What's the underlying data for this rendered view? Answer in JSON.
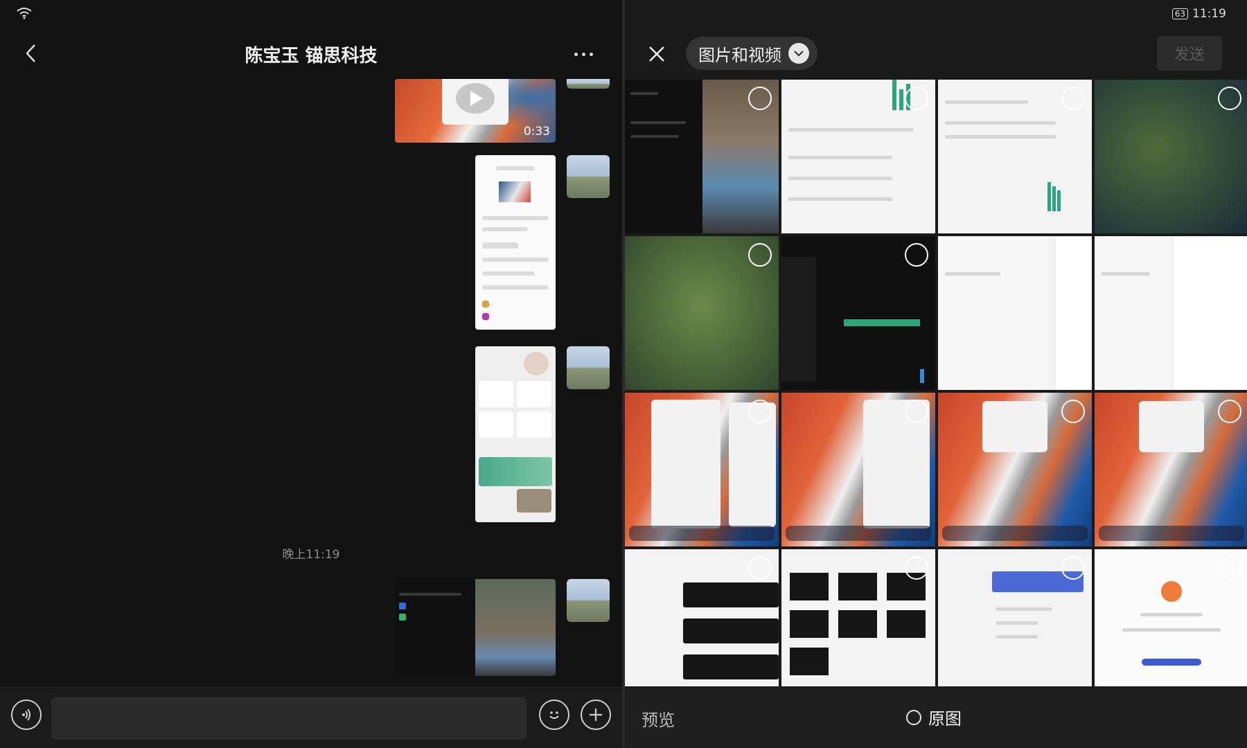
{
  "chat": {
    "title": "陈宝玉 锚思科技",
    "video_duration": "0:33",
    "time_label": "晚上11:19",
    "input_value": ""
  },
  "picker": {
    "clock": "11:19",
    "battery": "63",
    "album_label": "图片和视频",
    "send_label": "发送",
    "preview_label": "预览",
    "original_label": "原图"
  },
  "colors": {
    "chart_green": "#2aa57e",
    "send_disabled": "#5a5a5a"
  }
}
